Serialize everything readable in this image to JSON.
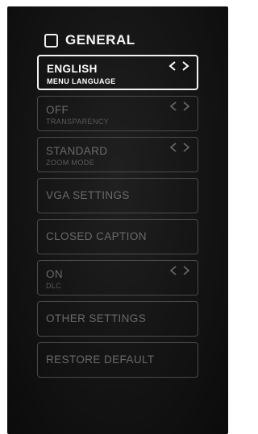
{
  "header": {
    "title": "GENERAL"
  },
  "menu": {
    "items": [
      {
        "value": "ENGLISH",
        "label": "MENU LANGUAGE",
        "selected": true
      },
      {
        "value": "OFF",
        "label": "TRANSPARENCY",
        "selected": false
      },
      {
        "value": "STANDARD",
        "label": "ZOOM MODE",
        "selected": false
      },
      {
        "value": "VGA SETTINGS"
      },
      {
        "value": "CLOSED CAPTION"
      },
      {
        "value": "ON",
        "label": "DLC",
        "selected": false
      },
      {
        "value": "OTHER SETTINGS"
      },
      {
        "value": "RESTORE DEFAULT"
      }
    ]
  },
  "icons": {
    "prev": "chevron-left-icon",
    "next": "chevron-right-icon",
    "section": "checkbox-icon"
  }
}
